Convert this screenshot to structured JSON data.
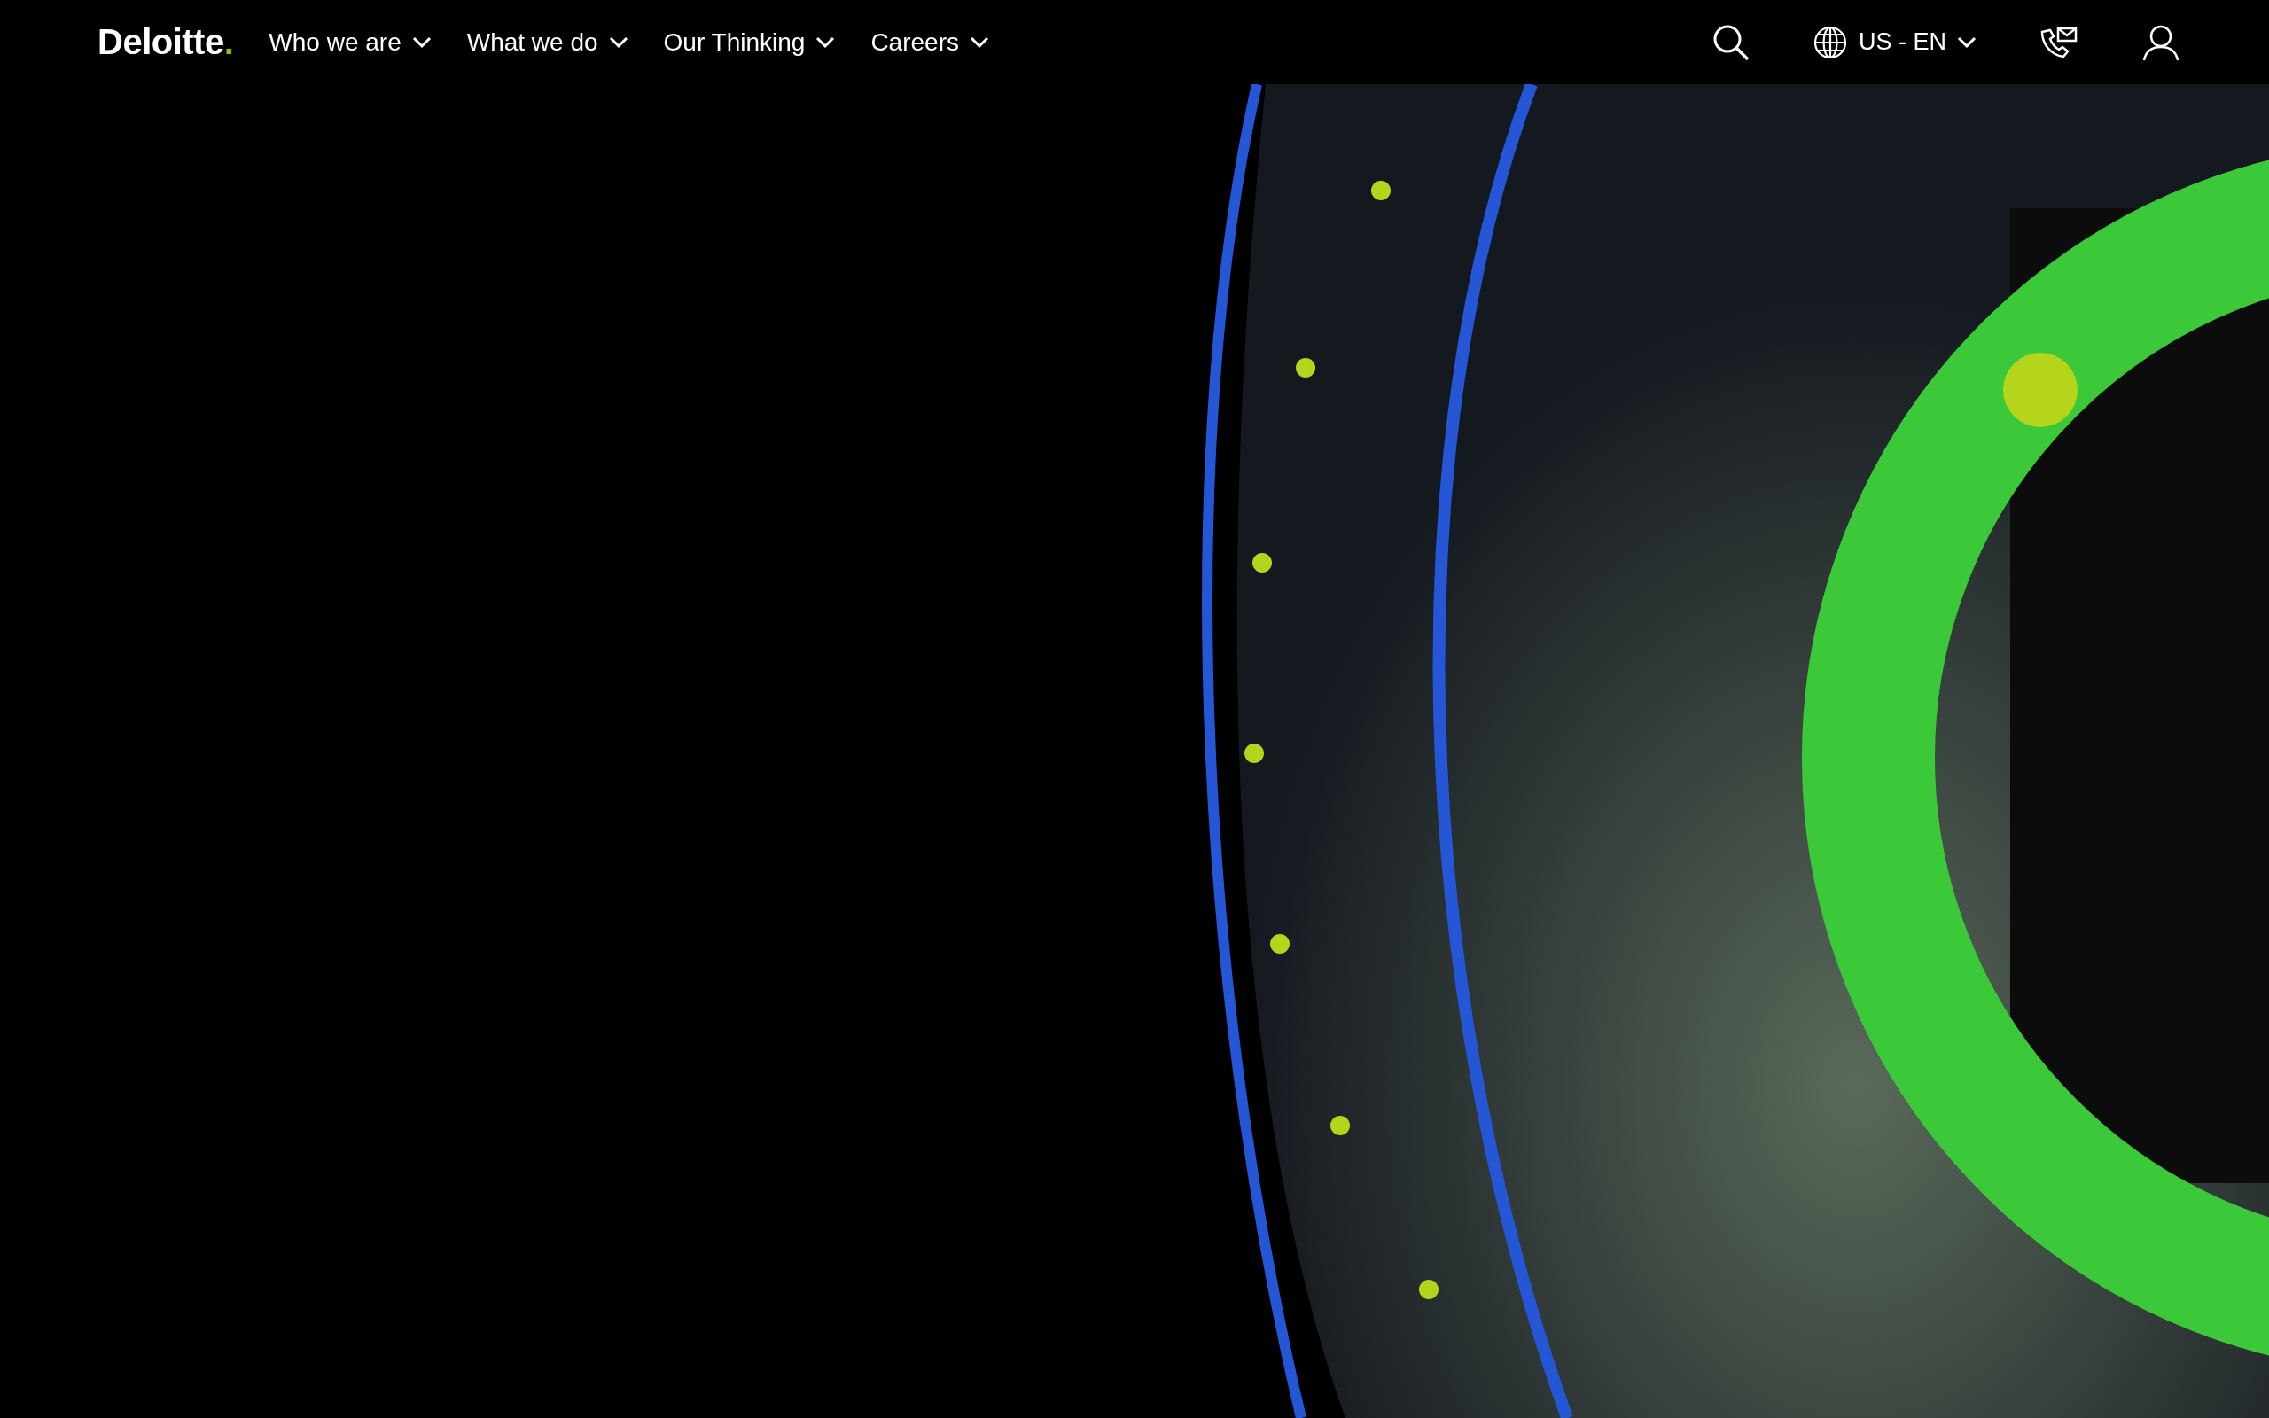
{
  "header": {
    "logo": "Deloitte.",
    "nav": [
      {
        "label": "Who we are",
        "expanded": false
      },
      {
        "label": "What we do",
        "expanded": false
      },
      {
        "label": "Our Thinking",
        "expanded": false
      },
      {
        "label": "Careers",
        "expanded": false
      }
    ],
    "locale": "US - EN"
  }
}
